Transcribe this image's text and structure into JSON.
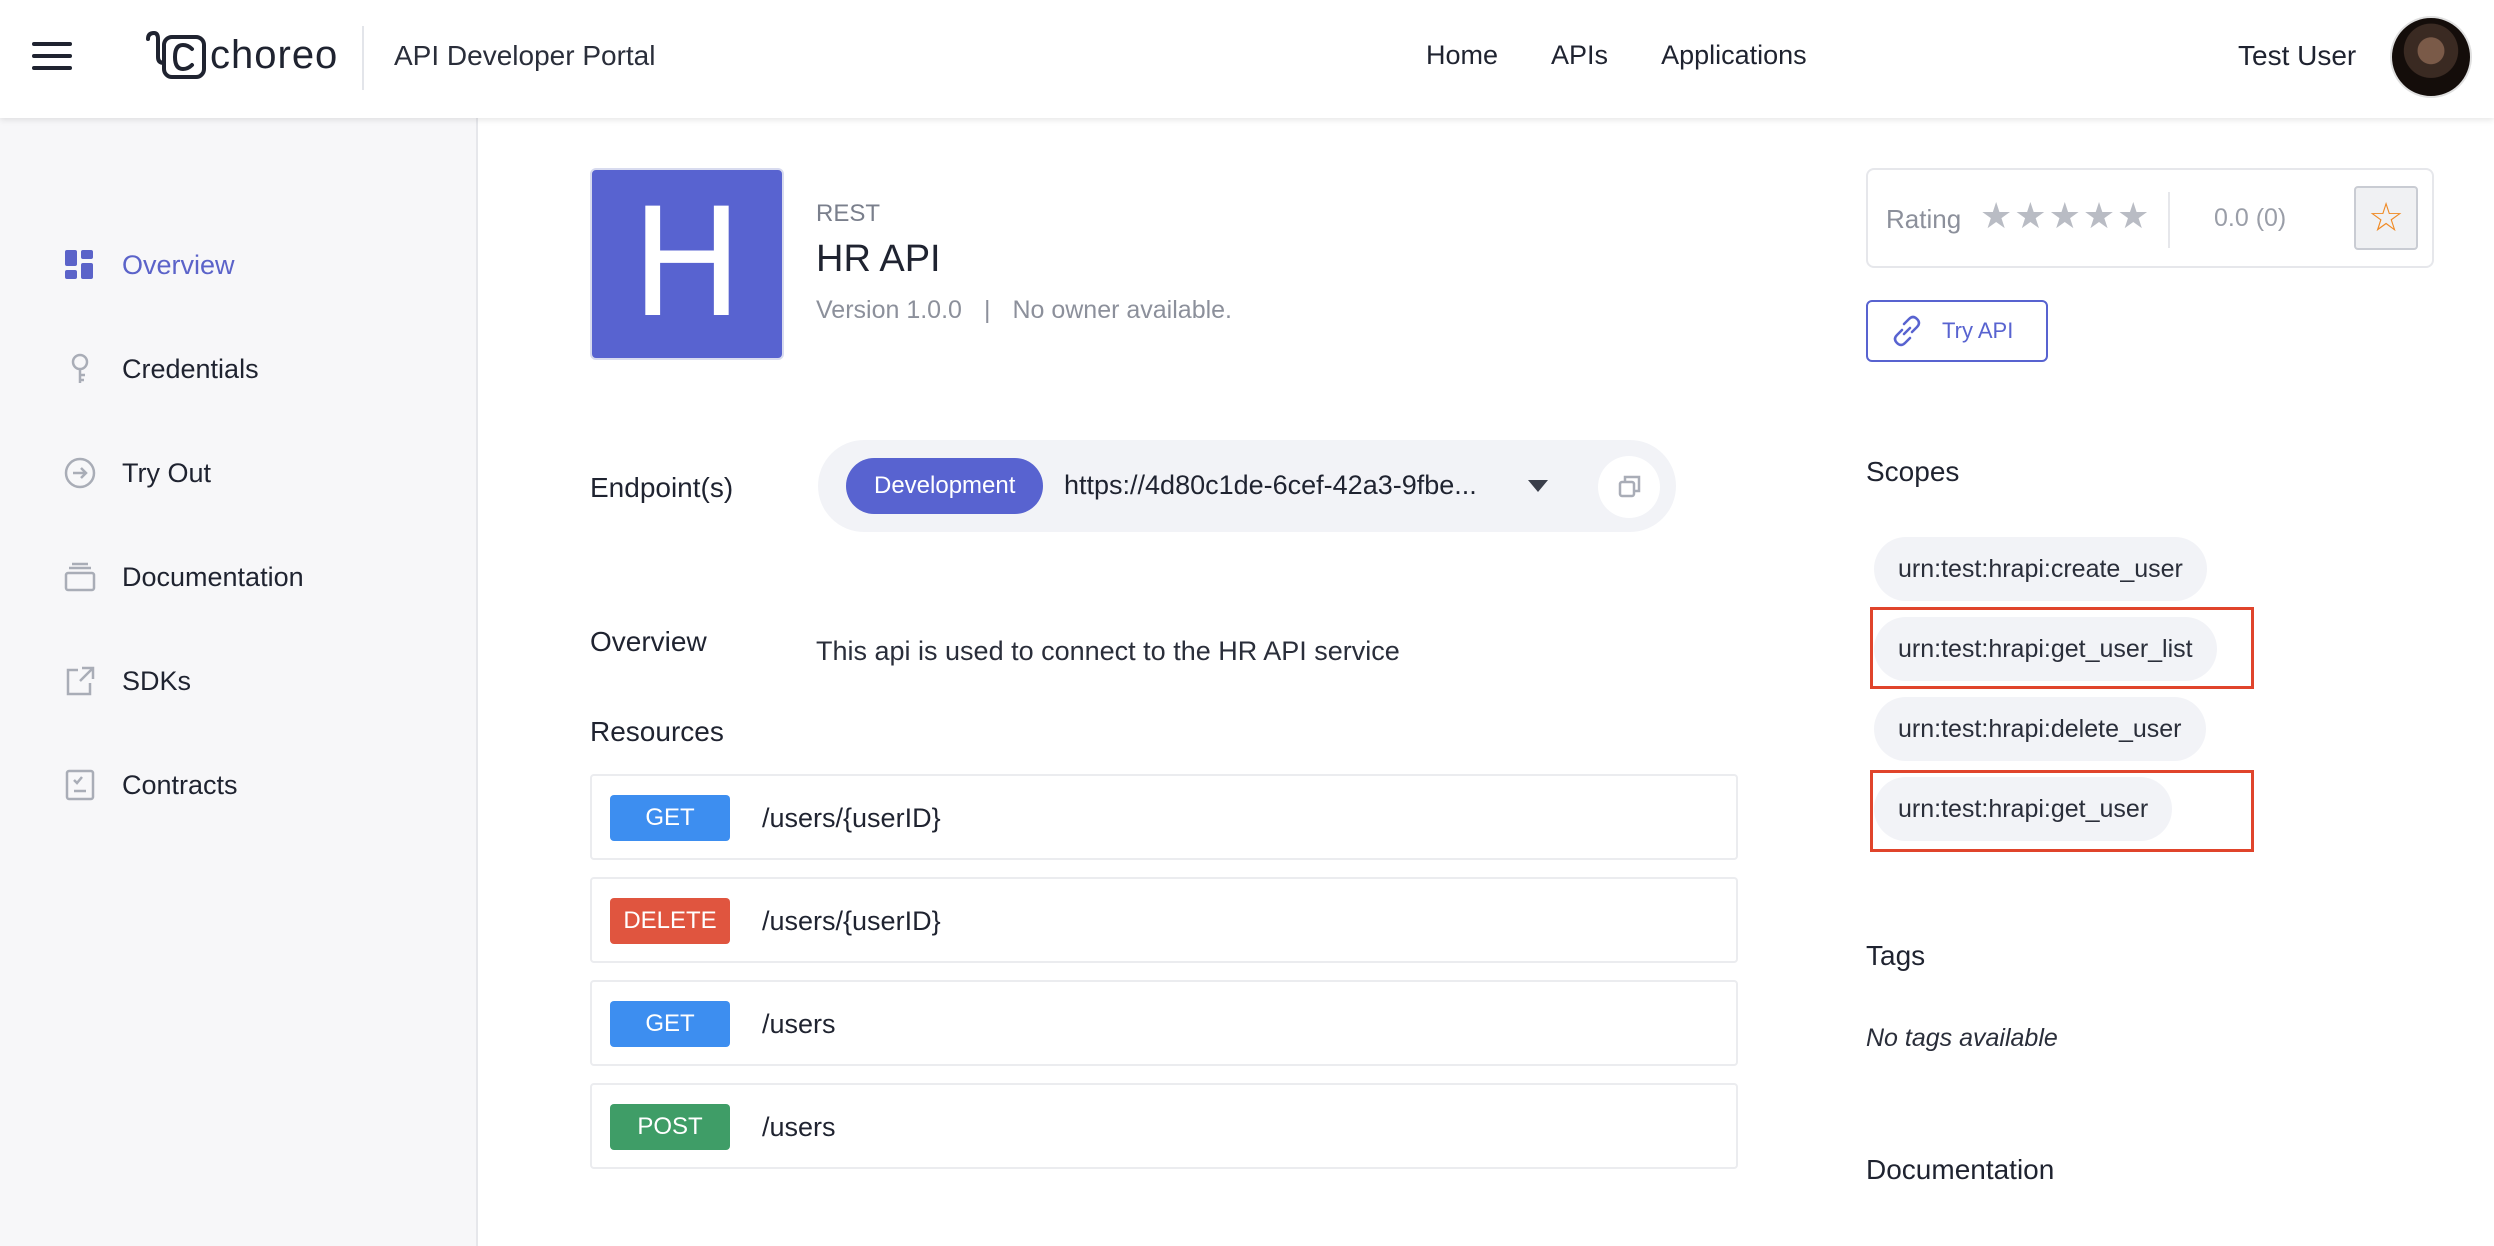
{
  "header": {
    "brand": "choreo",
    "portal_title": "API Developer Portal",
    "nav": [
      "Home",
      "APIs",
      "Applications"
    ],
    "user_name": "Test User"
  },
  "sidebar": {
    "items": [
      {
        "label": "Overview",
        "icon": "grid-icon",
        "active": true
      },
      {
        "label": "Credentials",
        "icon": "key-icon"
      },
      {
        "label": "Try Out",
        "icon": "arrow-circle-icon"
      },
      {
        "label": "Documentation",
        "icon": "stack-icon"
      },
      {
        "label": "SDKs",
        "icon": "export-icon"
      },
      {
        "label": "Contracts",
        "icon": "checklist-icon"
      }
    ]
  },
  "api": {
    "thumb_letter": "H",
    "type": "REST",
    "name": "HR API",
    "version": "Version 1.0.0",
    "separator": "|",
    "owner": "No owner available."
  },
  "endpoint": {
    "label": "Endpoint(s)",
    "environment": "Development",
    "url": "https://4d80c1de-6cef-42a3-9fbe..."
  },
  "overview": {
    "label": "Overview",
    "text": "This api is used to connect to the HR API service"
  },
  "resources": {
    "label": "Resources",
    "items": [
      {
        "method": "GET",
        "path": "/users/{userID}"
      },
      {
        "method": "DELETE",
        "path": "/users/{userID}"
      },
      {
        "method": "GET",
        "path": "/users"
      },
      {
        "method": "POST",
        "path": "/users"
      }
    ]
  },
  "rating": {
    "label": "Rating",
    "value": "0.0 (0)",
    "stars": 5
  },
  "try_api": {
    "label": "Try API"
  },
  "scopes": {
    "label": "Scopes",
    "items": [
      "urn:test:hrapi:create_user",
      "urn:test:hrapi:get_user_list",
      "urn:test:hrapi:delete_user",
      "urn:test:hrapi:get_user"
    ],
    "highlighted": [
      "urn:test:hrapi:get_user_list",
      "urn:test:hrapi:get_user"
    ]
  },
  "tags": {
    "label": "Tags",
    "empty_text": "No tags available"
  },
  "documentation": {
    "label": "Documentation"
  },
  "colors": {
    "accent": "#5863d0",
    "get": "#3d8ef0",
    "delete": "#e0553f",
    "post": "#3f9d67",
    "highlight": "#e0442b",
    "favorite": "#f08a24"
  }
}
